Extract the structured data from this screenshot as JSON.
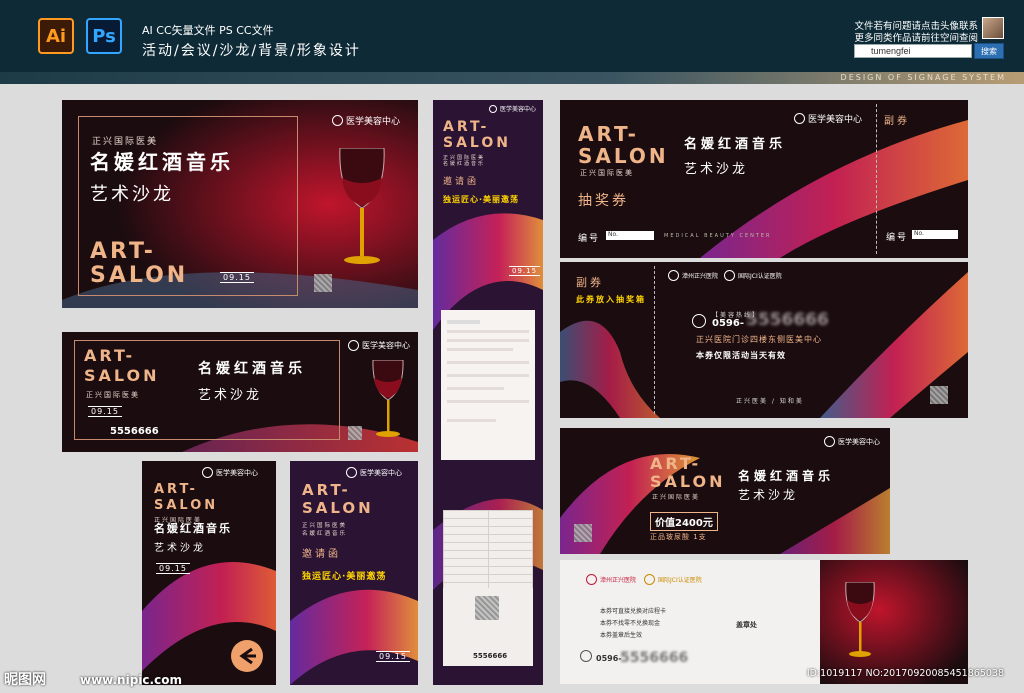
{
  "header": {
    "ai_label": "Ai",
    "ps_label": "Ps",
    "formats": "AI CC矢量文件   PS CC文件",
    "tagline": "活动/会议/沙龙/背景/形象设计",
    "contact_line1": "文件若有问题请点击头像联系",
    "contact_line2": "更多同类作品请前往空间查阅",
    "search_value": "tumengfei",
    "search_button": "搜索",
    "design_line": "DESIGN OF SIGNAGE SYSTEM"
  },
  "common": {
    "logo": "医学美容中心",
    "art": "ART-",
    "salon": "SALON",
    "org": "正兴国际医美",
    "title_main": "名媛红酒音乐",
    "title_sub": "艺术沙龙",
    "date": "09.15",
    "invite": "邀请函",
    "slogan": "独运匠心·美丽邀荡",
    "phone": "5556666"
  },
  "ticket": {
    "lottery": "抽奖券",
    "number_label": "编号",
    "number_placeholder": "No.",
    "stub": "副券",
    "stub_label": "副券",
    "drop_in": "此券放入抽奖箱",
    "hotline_label": "【美容热线】",
    "hotline": "0596-",
    "hotline_masked": "5556666",
    "venue": "正兴医院门诊四楼东侧医美中心",
    "valid_today": "本券仅限活动当天有效",
    "footer": "正兴医美 / 知和美",
    "hospital1": "漳州正兴医院",
    "hospital2": "国际JCI认证医院",
    "medical_beauty": "MEDICAL BEAUTY CENTER"
  },
  "voucher": {
    "value": "价值2400元",
    "item": "正品玻尿酸 1支",
    "rule1": "本券可直接兑换对应程卡",
    "rule2": "本券不找零不兑换现金",
    "rule3": "本券盖章后生效",
    "stamp": "盖章处",
    "phone_prefix": "0596-",
    "phone_masked": "5556666"
  },
  "footer": {
    "watermark": "昵图网",
    "url": "www.nipic.com",
    "id": "ID:1019117 NO:20170920085451865038"
  }
}
